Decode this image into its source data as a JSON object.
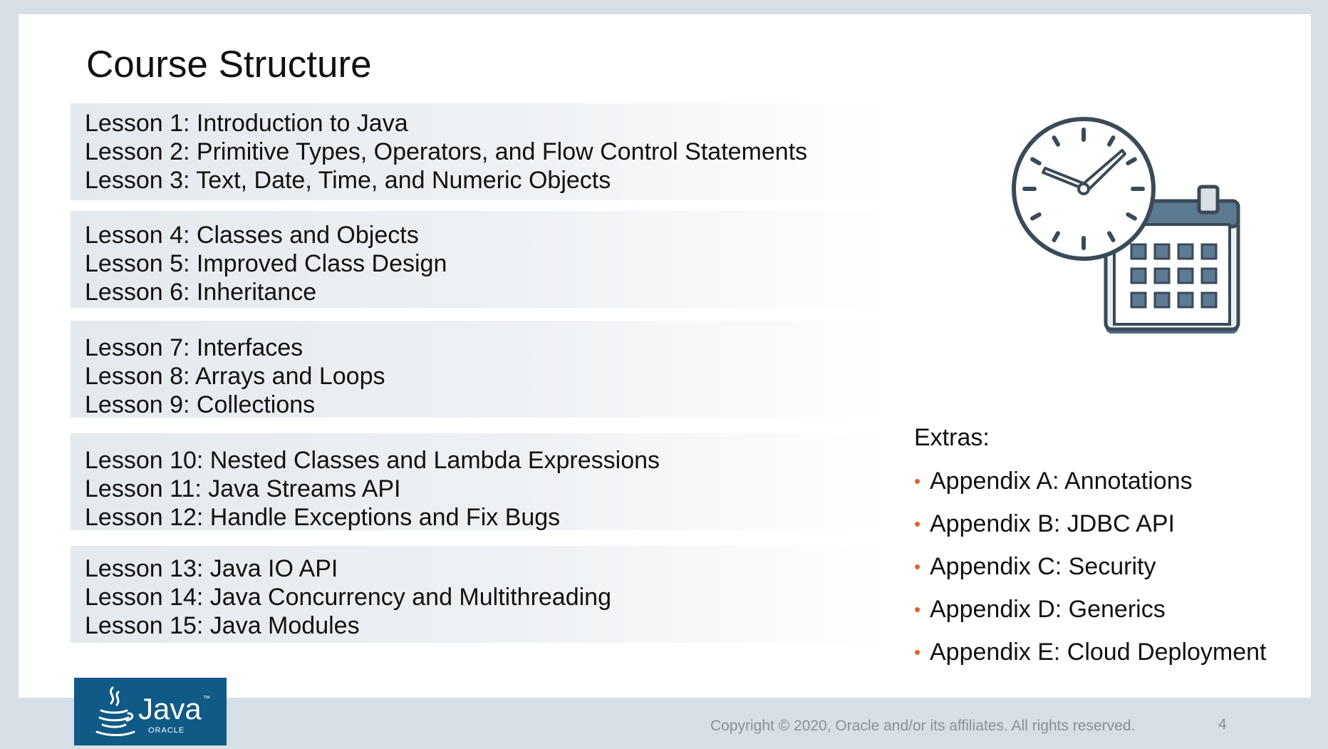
{
  "slide": {
    "title": "Course Structure",
    "lesson_groups": [
      {
        "lessons": [
          "Lesson 1: Introduction to Java",
          "Lesson 2: Primitive Types, Operators, and Flow Control Statements",
          "Lesson 3: Text, Date, Time, and Numeric Objects"
        ]
      },
      {
        "lessons": [
          "Lesson 4: Classes and Objects",
          "Lesson 5: Improved Class Design",
          "Lesson 6: Inheritance"
        ]
      },
      {
        "lessons": [
          "Lesson 7: Interfaces",
          "Lesson 8: Arrays and Loops",
          "Lesson 9: Collections"
        ]
      },
      {
        "lessons": [
          "Lesson 10: Nested Classes and Lambda Expressions",
          "Lesson 11: Java Streams API",
          "Lesson 12: Handle Exceptions and Fix Bugs"
        ]
      },
      {
        "lessons": [
          "Lesson 13: Java IO API",
          "Lesson 14: Java Concurrency and Multithreading",
          "Lesson 15: Java Modules"
        ]
      }
    ],
    "extras": {
      "title": "Extras:",
      "bullet": "•",
      "items": [
        "Appendix A: Annotations",
        "Appendix B: JDBC API",
        "Appendix C: Security",
        "Appendix D: Generics",
        "Appendix E: Cloud Deployment"
      ]
    },
    "illustration": {
      "icons": [
        "clock-icon",
        "calendar-icon"
      ]
    }
  },
  "footer": {
    "logo": {
      "text": "Java",
      "trademark": "™",
      "subtext": "ORACLE"
    },
    "copyright": "Copyright © 2020, Oracle and/or its affiliates. All rights reserved.",
    "page_number": "4"
  },
  "colors": {
    "background": "#d6dfe5",
    "slide": "#ffffff",
    "group_band": "#e4e9ed",
    "bullet": "#e0642a",
    "logo_bg": "#0f5a86",
    "icon_stroke": "#3a4a57",
    "calendar_fill": "#5d7a93"
  }
}
